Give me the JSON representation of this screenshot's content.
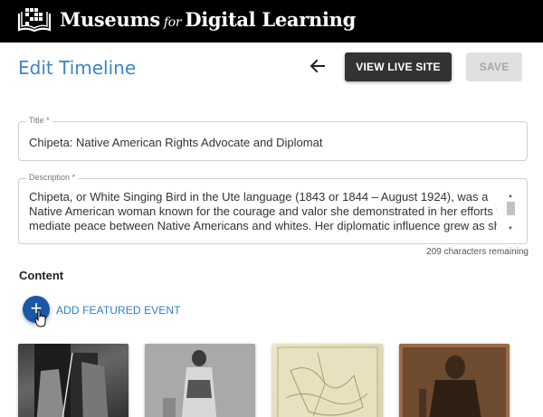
{
  "header": {
    "brand_main": "Museums",
    "brand_for": "for",
    "brand_end": "Digital Learning",
    "logo_icon": "book-grid-logo-icon",
    "background": "#000000"
  },
  "toolbar": {
    "page_title": "Edit Timeline",
    "back_icon": "arrow-left-icon",
    "view_live_label": "VIEW LIVE SITE",
    "save_label": "SAVE",
    "accent_color": "#3a86c8"
  },
  "form": {
    "title_label": "Title *",
    "title_value": "Chipeta: Native American Rights Advocate and Diplomat",
    "description_label": "Description *",
    "description_lines": [
      "Chipeta, or White Singing Bird in the Ute language (1843 or 1844 – August 1924), was a",
      "Native American woman known for the courage and valor she demonstrated in her efforts to",
      "mediate peace between Native Americans and whites.  Her diplomatic influence grew as she"
    ],
    "chars_remaining": "209 characters remaining"
  },
  "content": {
    "heading": "Content",
    "add_label": "ADD FEATURED EVENT",
    "add_icon": "plus-icon",
    "add_color": "#1a58a7"
  }
}
